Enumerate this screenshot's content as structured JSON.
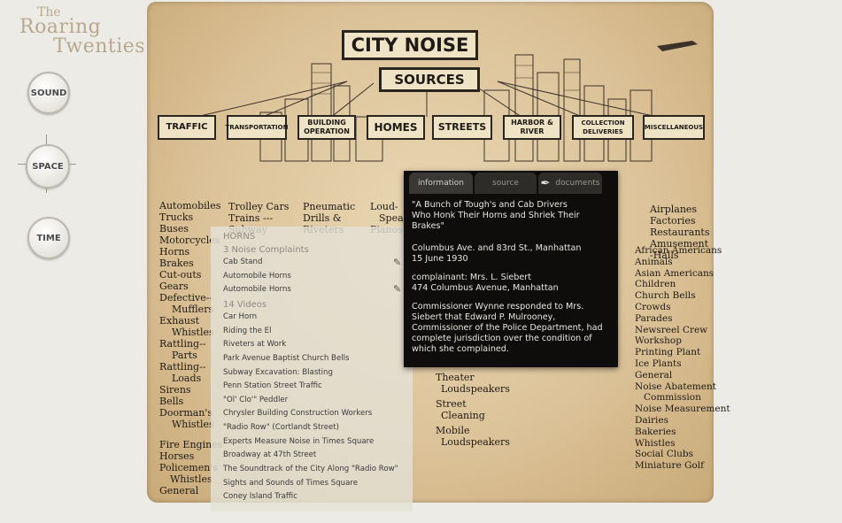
{
  "logo": {
    "line1": "The",
    "line2": "Roaring",
    "line3": "Twenties"
  },
  "nav": [
    {
      "label": "SOUND",
      "icon": "sound-icon"
    },
    {
      "label": "SPACE",
      "icon": "compass-icon"
    },
    {
      "label": "TIME",
      "icon": "time-icon"
    }
  ],
  "poster": {
    "title": "CITY NOISE",
    "subtitle": "SOURCES",
    "categories": [
      "TRAFFIC",
      "TRANSPORTATION",
      "BUILDING OPERATION",
      "HOMES",
      "STREETS",
      "HARBOR & RIVER",
      "COLLECTION DELIVERIES",
      "MISCELLANEOUS"
    ],
    "traffic_list": [
      "Automobiles",
      "Trucks",
      "Buses",
      "Motorcycles",
      "Horns",
      "Brakes",
      "Cut-outs",
      "Gears",
      "Defective--",
      "Mufflers",
      "Exhaust",
      "Whistles",
      "Rattling--",
      "Parts",
      "Rattling--",
      "Loads",
      "Sirens",
      "Bells",
      "Doorman's",
      "Whistles",
      "Fire Engines",
      "Horses",
      "Policemen's",
      "Whistles",
      "General"
    ],
    "transport_list": [
      "Trolley Cars",
      "Trains ---",
      "Subway"
    ],
    "building_list": [
      "Pneumatic",
      "Drills &",
      "Riveters"
    ],
    "homes_list": [
      "Loud-",
      "Speak",
      "Pianos"
    ],
    "streets_list": [
      "Theater",
      "Loudspeakers",
      "Street",
      "Cleaning",
      "Mobile",
      "Loudspeakers"
    ],
    "misc_top": [
      "Airplanes",
      "Factories",
      "Restaurants",
      "Amusement",
      "-Halls"
    ],
    "misc_list": [
      "African Americans",
      "Animals",
      "Asian Americans",
      "Children",
      "Church Bells",
      "Crowds",
      "Parades",
      "Newsreel Crew",
      "Workshop",
      "Printing Plant",
      "Ice Plants",
      "General",
      "Noise Abatement",
      "Commission",
      "Noise Measurement",
      "Dairies",
      "Bakeries",
      "Whistles",
      "Social Clubs",
      "Miniature Golf"
    ]
  },
  "panel": {
    "heading": "HORNS",
    "complaints_heading": "3 Noise Complaints",
    "complaints": [
      "Cab Stand",
      "Automobile Horns",
      "Automobile Horns"
    ],
    "videos_heading": "14 Videos",
    "videos": [
      "Car Horn",
      "Riding the El",
      "Riveters at Work",
      "Park Avenue Baptist Church Bells",
      "Subway Excavation: Blasting",
      "Penn Station Street Traffic",
      "\"Ol' Clo'\" Peddler",
      "Chrysler Building Construction Workers",
      "\"Radio Row\" (Cortlandt Street)",
      "Experts Measure Noise in Times Square",
      "Broadway at 47th Street",
      "The Soundtrack of the City Along \"Radio Row\"",
      "Sights and Sounds of Times Square",
      "Coney Island Traffic"
    ]
  },
  "info": {
    "tabs": [
      "information",
      "source",
      "documents"
    ],
    "quote": [
      "\"A Bunch of Tough's and Cab Drivers",
      "Who Honk Their Horns and Shriek Their",
      "Brakes\""
    ],
    "location": "Columbus Ave. and 83rd St., Manhattan",
    "date": "15 June 1930",
    "complainant": "complainant: Mrs. L. Siebert",
    "address": "474 Columbus Avenue, Manhattan",
    "response": [
      "Commissioner Wynne responded to Mrs.",
      "Siebert that Edward P. Mulrooney,",
      "Commissioner of the Police Department, had",
      "complete jurisdiction over the condition of",
      "which she complained."
    ]
  }
}
